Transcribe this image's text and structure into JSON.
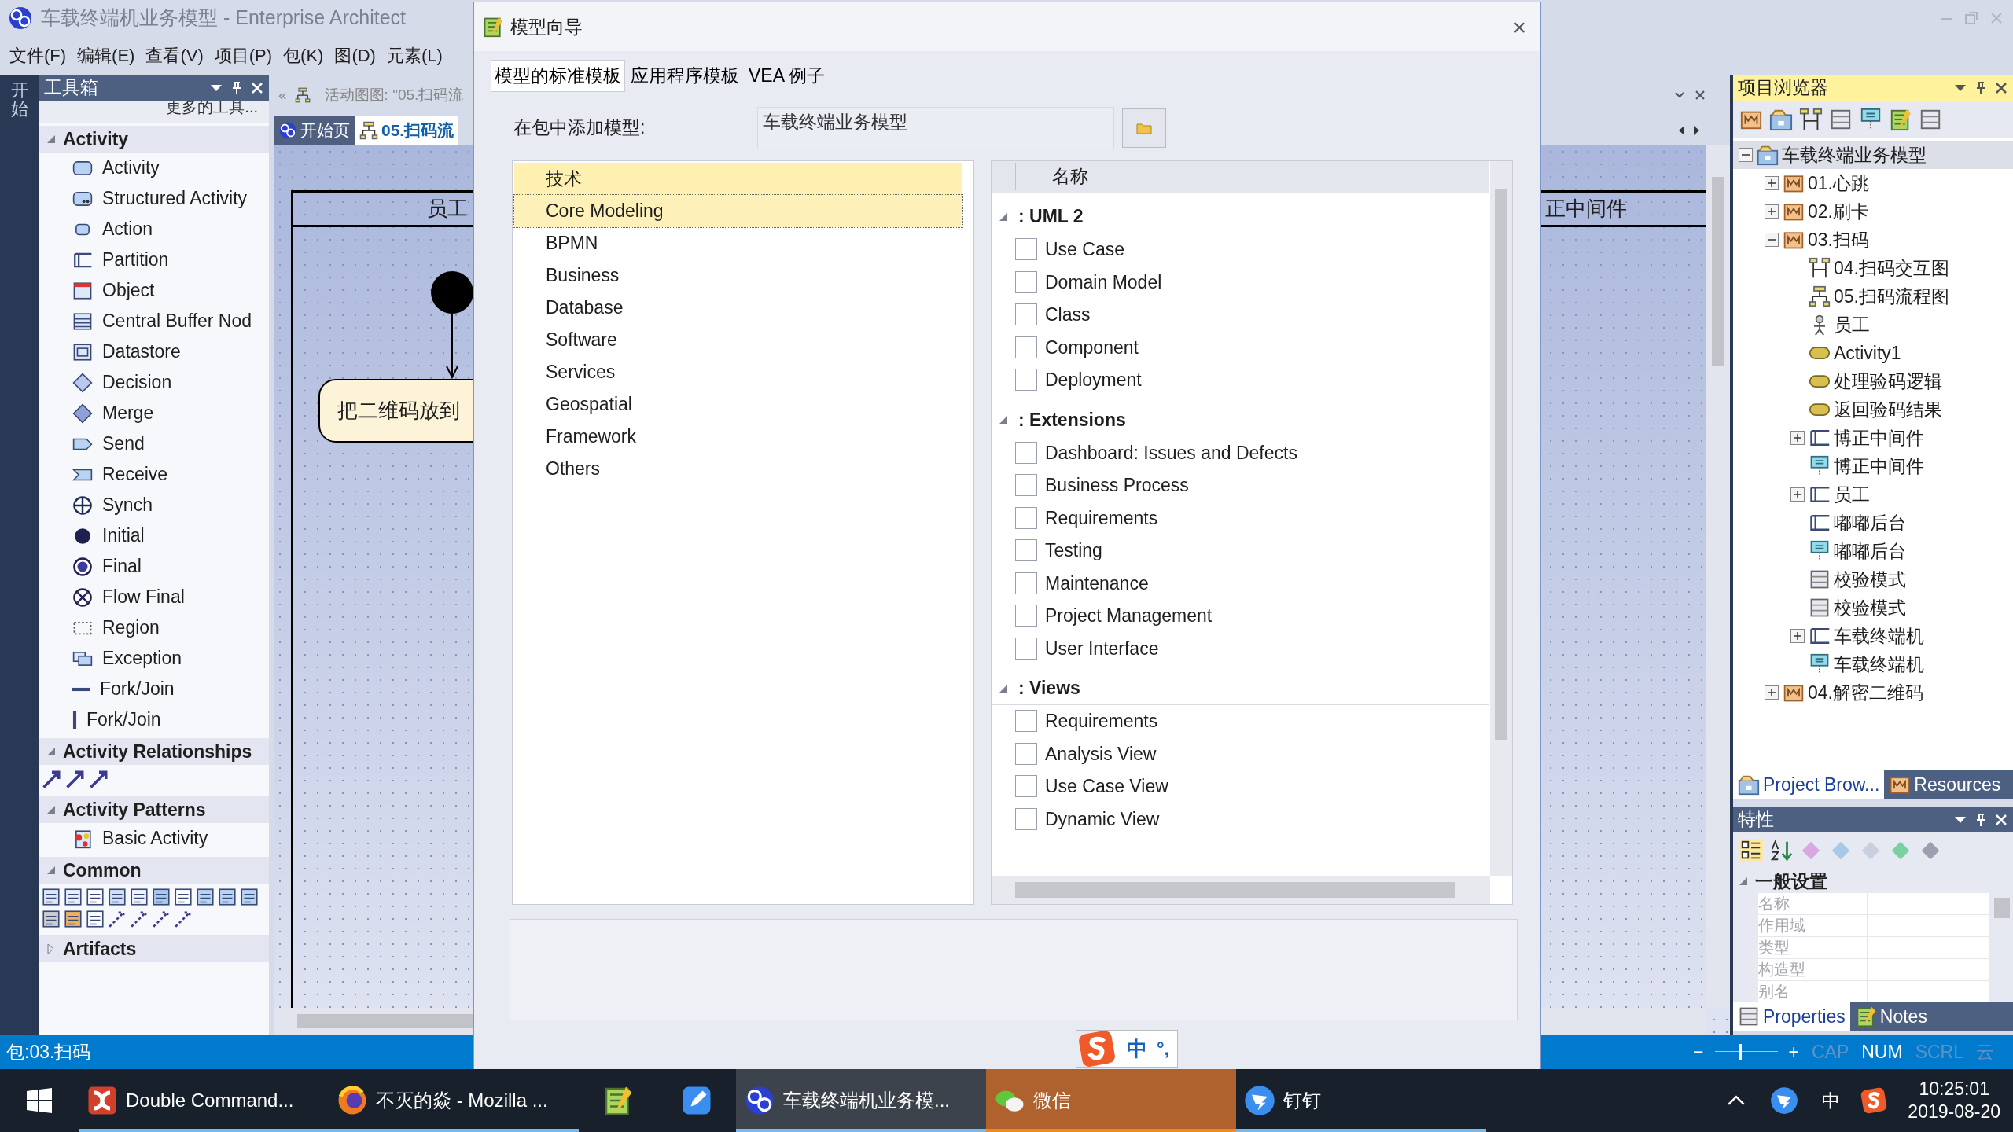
{
  "window": {
    "title": "车载终端机业务模型 - Enterprise Architect"
  },
  "menu": [
    "文件(F)",
    "编辑(E)",
    "查看(V)",
    "项目(P)",
    "包(K)",
    "图(D)",
    "元素(L)"
  ],
  "left_strip": {
    "label": "开始"
  },
  "toolbox": {
    "title": "工具箱",
    "more": "更多的工具...",
    "groups": [
      {
        "name": "Activity",
        "kind": "items",
        "expanded": true,
        "items": [
          {
            "label": "Activity",
            "kind": "activity"
          },
          {
            "label": "Structured Activity",
            "kind": "structured"
          },
          {
            "label": "Action",
            "kind": "action"
          },
          {
            "label": "Partition",
            "kind": "partition"
          },
          {
            "label": "Object",
            "kind": "object"
          },
          {
            "label": "Central Buffer Nod",
            "kind": "buffer"
          },
          {
            "label": "Datastore",
            "kind": "datastore"
          },
          {
            "label": "Decision",
            "kind": "decision"
          },
          {
            "label": "Merge",
            "kind": "merge"
          },
          {
            "label": "Send",
            "kind": "send"
          },
          {
            "label": "Receive",
            "kind": "receive"
          },
          {
            "label": "Synch",
            "kind": "synch"
          },
          {
            "label": "Initial",
            "kind": "initial"
          },
          {
            "label": "Final",
            "kind": "final"
          },
          {
            "label": "Flow Final",
            "kind": "flow_final"
          },
          {
            "label": "Region",
            "kind": "region"
          },
          {
            "label": "Exception",
            "kind": "exception"
          },
          {
            "label": "Fork/Join",
            "kind": "fork_h"
          },
          {
            "label": "Fork/Join",
            "kind": "fork_v"
          }
        ]
      },
      {
        "name": "Activity Relationships",
        "kind": "relationship_icons",
        "expanded": true
      },
      {
        "name": "Activity Patterns",
        "kind": "items",
        "expanded": true,
        "items": [
          {
            "label": "Basic Activity",
            "kind": "pattern"
          }
        ]
      },
      {
        "name": "Common",
        "kind": "common_icons",
        "expanded": true
      },
      {
        "name": "Artifacts",
        "kind": "items",
        "expanded": false
      }
    ]
  },
  "diagram": {
    "collapse": "«",
    "caption": "活动图图: \"05.扫码流",
    "tabs": [
      {
        "label": "开始页",
        "kind": "ea",
        "selected": false
      },
      {
        "label": "05.扫码流",
        "kind": "actdiag",
        "selected": true
      }
    ],
    "lanes": [
      {
        "label": "员工"
      },
      {
        "label": "正中间件"
      }
    ],
    "action": {
      "label": "把二维码放到"
    }
  },
  "dialog": {
    "title": "模型向导",
    "close": "×",
    "tabs": [
      {
        "label": "模型的标准模板",
        "selected": true
      },
      {
        "label": "应用程序模板",
        "selected": false
      },
      {
        "label": "VEA 例子",
        "selected": false
      }
    ],
    "package_label": "在包中添加模型:",
    "package_value": "车载终端业务模型",
    "technologies": {
      "header": "技术",
      "items": [
        {
          "label": "Core Modeling",
          "selected": true
        },
        {
          "label": "BPMN",
          "selected": false
        },
        {
          "label": "Business",
          "selected": false
        },
        {
          "label": "Database",
          "selected": false
        },
        {
          "label": "Software",
          "selected": false
        },
        {
          "label": "Services",
          "selected": false
        },
        {
          "label": "Geospatial",
          "selected": false
        },
        {
          "label": "Framework",
          "selected": false
        },
        {
          "label": "Others",
          "selected": false
        }
      ]
    },
    "templates": {
      "header": "名称",
      "groups": [
        {
          "name": ": UML 2",
          "expanded": true,
          "items": [
            {
              "label": "Use Case",
              "checked": false
            },
            {
              "label": "Domain Model",
              "checked": false
            },
            {
              "label": "Class",
              "checked": false
            },
            {
              "label": "Component",
              "checked": false
            },
            {
              "label": "Deployment",
              "checked": false
            }
          ]
        },
        {
          "name": ": Extensions",
          "expanded": true,
          "items": [
            {
              "label": "Dashboard: Issues and Defects",
              "checked": false
            },
            {
              "label": "Business Process",
              "checked": false
            },
            {
              "label": "Requirements",
              "checked": false
            },
            {
              "label": "Testing",
              "checked": false
            },
            {
              "label": "Maintenance",
              "checked": false
            },
            {
              "label": "Project Management",
              "checked": false
            },
            {
              "label": "User Interface",
              "checked": false
            }
          ]
        },
        {
          "name": ": Views",
          "expanded": true,
          "items": [
            {
              "label": "Requirements",
              "checked": false
            },
            {
              "label": "Analysis View",
              "checked": false
            },
            {
              "label": "Use Case View",
              "checked": false
            },
            {
              "label": "Dynamic View",
              "checked": false
            }
          ]
        }
      ]
    }
  },
  "ime": {
    "mode": "中",
    "punct": "°,"
  },
  "project_browser": {
    "title": "项目浏览器",
    "tree": [
      {
        "label": "车载终端业务模型",
        "kind": "model",
        "selected": true,
        "expanded": true,
        "children": [
          {
            "label": "01.心跳",
            "kind": "package",
            "selected": false,
            "expanded": false
          },
          {
            "label": "02.刷卡",
            "kind": "package",
            "selected": false,
            "expanded": false
          },
          {
            "label": "03.扫码",
            "kind": "package",
            "selected": false,
            "expanded": true,
            "children": [
              {
                "label": "04.扫码交互图",
                "kind": "seqdiag",
                "selected": false
              },
              {
                "label": "05.扫码流程图",
                "kind": "actdiag",
                "selected": false
              },
              {
                "label": "员工",
                "kind": "actor",
                "selected": false
              },
              {
                "label": "Activity1",
                "kind": "pill",
                "selected": false
              },
              {
                "label": "处理验码逻辑",
                "kind": "pill",
                "selected": false
              },
              {
                "label": "返回验码结果",
                "kind": "pill",
                "selected": false
              },
              {
                "label": "博正中间件",
                "kind": "partition",
                "selected": false,
                "expanded": false
              },
              {
                "label": "博正中间件",
                "kind": "node",
                "selected": false
              },
              {
                "label": "员工",
                "kind": "partition",
                "selected": false,
                "expanded": false
              },
              {
                "label": "嘟嘟后台",
                "kind": "partition",
                "selected": false
              },
              {
                "label": "嘟嘟后台",
                "kind": "node",
                "selected": false
              },
              {
                "label": "校验模式",
                "kind": "class",
                "selected": false
              },
              {
                "label": "校验模式",
                "kind": "class",
                "selected": false
              },
              {
                "label": "车载终端机",
                "kind": "partition",
                "selected": false,
                "expanded": false
              },
              {
                "label": "车载终端机",
                "kind": "node",
                "selected": false
              }
            ]
          },
          {
            "label": "04.解密二维码",
            "kind": "package",
            "selected": false,
            "expanded": false
          }
        ]
      }
    ],
    "tabs": [
      {
        "label": "Project Brow...",
        "selected": true
      },
      {
        "label": "Resources",
        "selected": false
      }
    ]
  },
  "properties": {
    "title": "特性",
    "section": "一般设置",
    "fields": [
      {
        "label": "名称",
        "disabled": true
      },
      {
        "label": "作用域",
        "disabled": true
      },
      {
        "label": "类型",
        "disabled": true
      },
      {
        "label": "构造型",
        "disabled": true
      },
      {
        "label": "别名",
        "disabled": true
      }
    ],
    "tabs": [
      {
        "label": "Properties",
        "selected": true
      },
      {
        "label": "Notes",
        "selected": false
      }
    ]
  },
  "status_bar": {
    "text": "包:03.扫码",
    "zoom_out": "−",
    "zoom": {
      "level": 0.4
    },
    "zoom_in": "+",
    "keys": [
      {
        "label": "CAP",
        "on": false
      },
      {
        "label": "NUM",
        "on": true
      },
      {
        "label": "SCRL",
        "on": false
      },
      {
        "label": "云",
        "on": false
      }
    ]
  },
  "taskbar": {
    "apps": [
      {
        "label": "Double Command...",
        "kind": "dc",
        "running": true,
        "selected": false,
        "flashing": false
      },
      {
        "label": "不灭的焱 - Mozilla ...",
        "kind": "firefox",
        "running": true,
        "selected": false,
        "flashing": false
      },
      {
        "kind": "notepad",
        "running": false,
        "selected": false,
        "flashing": false
      },
      {
        "kind": "note",
        "running": false,
        "selected": false,
        "flashing": false
      },
      {
        "label": "车载终端机业务模...",
        "kind": "ea",
        "running": true,
        "selected": true,
        "flashing": false
      },
      {
        "label": "微信",
        "kind": "wechat",
        "running": true,
        "selected": false,
        "flashing": true
      },
      {
        "label": "钉钉",
        "kind": "dingtalk",
        "running": true,
        "selected": false,
        "flashing": false
      }
    ],
    "tray": {
      "ime": "中",
      "time": "10:25:01",
      "date": "2019-08-20"
    }
  }
}
